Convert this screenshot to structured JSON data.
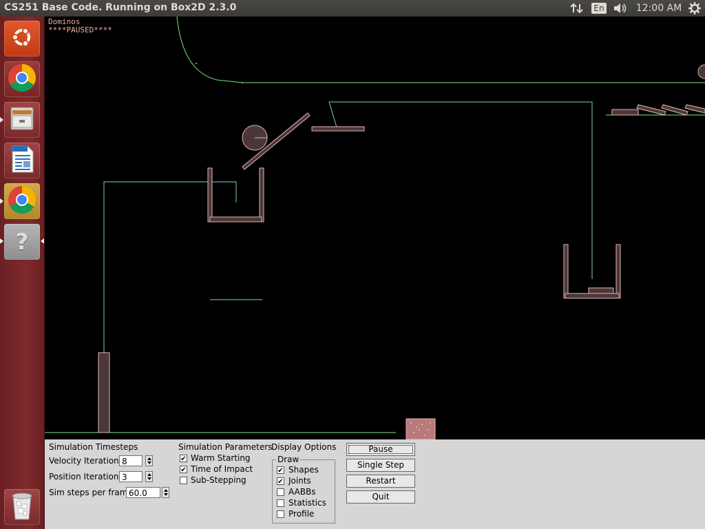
{
  "topbar": {
    "title": "CS251 Base Code. Running on Box2D 2.3.0",
    "language": "En",
    "clock": "12:00 AM",
    "icons": [
      "network-arrows-icon",
      "keyboard-language-icon",
      "volume-icon",
      "session-gear-icon"
    ]
  },
  "launcher": {
    "items": [
      {
        "name": "ubuntu-dash",
        "icon": "ubuntu-logo-icon"
      },
      {
        "name": "chrome",
        "icon": "chrome-icon"
      },
      {
        "name": "files",
        "icon": "file-cabinet-icon"
      },
      {
        "name": "libreoffice-writer",
        "icon": "writer-document-icon"
      },
      {
        "name": "chrome-active",
        "icon": "chrome-icon"
      },
      {
        "name": "help",
        "icon": "question-mark-icon",
        "glyph": "?"
      },
      {
        "name": "trash",
        "icon": "trash-icon"
      }
    ]
  },
  "sim": {
    "title": "Dominos",
    "status": "****PAUSED****",
    "colors": {
      "shape": "#e6b3b3",
      "shape_dark": "#4a3838",
      "joint": "#80cccc",
      "static": "#80e680"
    }
  },
  "panel": {
    "timesteps_header": "Simulation Timesteps",
    "velocity_label": "Velocity Iterations",
    "velocity_value": "8",
    "position_label": "Position Iterations",
    "position_value": "3",
    "steps_label": "Sim steps per frame",
    "steps_value": "60.0",
    "params_header": "Simulation Parameters",
    "warm_label": "Warm Starting",
    "warm_checked": true,
    "toi_label": "Time of Impact",
    "toi_checked": true,
    "substep_label": "Sub-Stepping",
    "substep_checked": false,
    "display_header": "Display Options",
    "draw_legend": "Draw",
    "draw_items": [
      {
        "label": "Shapes",
        "checked": true
      },
      {
        "label": "Joints",
        "checked": true
      },
      {
        "label": "AABBs",
        "checked": false
      },
      {
        "label": "Statistics",
        "checked": false
      },
      {
        "label": "Profile",
        "checked": false
      }
    ],
    "buttons": {
      "pause": "Pause",
      "single_step": "Single Step",
      "restart": "Restart",
      "quit": "Quit"
    }
  }
}
